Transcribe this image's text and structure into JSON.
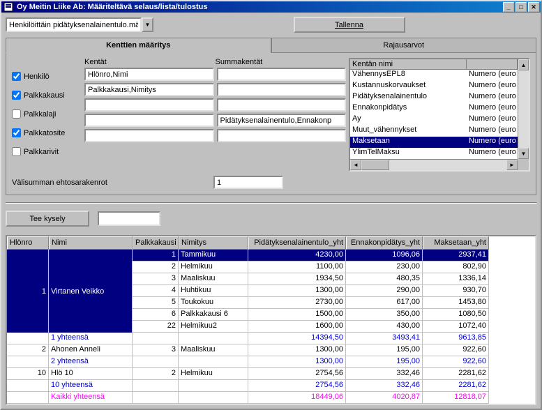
{
  "window": {
    "title": "Oy Meitin Liike Ab: Määriteltävä selaus/lista/tulostus"
  },
  "combo": {
    "value": "Henkilöittäin pidätyksenalainentulo.mäs"
  },
  "buttons": {
    "tallenna": "Tallenna",
    "kysely": "Tee kysely"
  },
  "tabs": {
    "t1": "Kenttien määritys",
    "t2": "Rajausarvot"
  },
  "labels": {
    "kentat": "Kentät",
    "summa": "Summakentät",
    "sumrak": "Välisumman ehtosarakenrot"
  },
  "checks": {
    "henkilo": "Henkilö",
    "palkkakausi": "Palkkakausi",
    "palkkalaji": "Palkkalaji",
    "palkkatosite": "Palkkatosite",
    "palkkarivit": "Palkkarivit"
  },
  "fields": {
    "f1": "Hlönro,Nimi",
    "f2": "Palkkakausi,Nimitys",
    "f3": "",
    "f4": "",
    "f5": "",
    "s1": "",
    "s2": "",
    "s3": "",
    "s4": "Pidätyksenalainentulo,Ennakonp",
    "s5": ""
  },
  "sumval": "1",
  "list": {
    "hdr1": "Kentän nimi",
    "hdr2": "",
    "rows": [
      {
        "n": "VähennysEPL8",
        "t": "Numero (euro"
      },
      {
        "n": "Kustannuskorvaukset",
        "t": "Numero (euro"
      },
      {
        "n": "Pidätyksenalainentulo",
        "t": "Numero (euro"
      },
      {
        "n": "Ennakonpidätys",
        "t": "Numero (euro"
      },
      {
        "n": "Ay",
        "t": "Numero (euro"
      },
      {
        "n": "Muut_vähennykset",
        "t": "Numero (euro"
      },
      {
        "n": "Maksetaan",
        "t": "Numero (euro",
        "sel": true
      },
      {
        "n": "YlimTelMaksu",
        "t": "Numero (euro"
      }
    ]
  },
  "grid": {
    "cols": [
      "Hlönro",
      "Nimi",
      "Palkkakausi",
      "Nimitys",
      "Pidätyksenalainentulo_yht",
      "Ennakonpidätys_yht",
      "Maksetaan_yht"
    ],
    "group": {
      "hlonro": "1",
      "nimi": "Virtanen Veikko"
    },
    "rows": [
      {
        "pk": "1",
        "nim": "Tammikuu",
        "a": "4230,00",
        "b": "1096,06",
        "c": "2937,41",
        "sel": true
      },
      {
        "pk": "2",
        "nim": "Helmikuu",
        "a": "1100,00",
        "b": "230,00",
        "c": "802,90"
      },
      {
        "pk": "3",
        "nim": "Maaliskuu",
        "a": "1934,50",
        "b": "480,35",
        "c": "1336,14"
      },
      {
        "pk": "4",
        "nim": "Huhtikuu",
        "a": "1300,00",
        "b": "290,00",
        "c": "930,70"
      },
      {
        "pk": "5",
        "nim": "Toukokuu",
        "a": "2730,00",
        "b": "617,00",
        "c": "1453,80"
      },
      {
        "pk": "6",
        "nim": "Palkkakausi 6",
        "a": "1500,00",
        "b": "350,00",
        "c": "1080,50"
      },
      {
        "pk": "22",
        "nim": "Helmikuu2",
        "a": "1600,00",
        "b": "430,00",
        "c": "1072,40"
      }
    ],
    "sub1": {
      "label": "1 yhteensä",
      "a": "14394,50",
      "b": "3493,41",
      "c": "9613,85"
    },
    "r2": {
      "hlonro": "2",
      "nimi": "Ahonen Anneli",
      "pk": "3",
      "nim": "Maaliskuu",
      "a": "1300,00",
      "b": "195,00",
      "c": "922,60"
    },
    "sub2": {
      "label": "2 yhteensä",
      "a": "1300,00",
      "b": "195,00",
      "c": "922,60"
    },
    "r3": {
      "hlonro": "10",
      "nimi": "Hlö 10",
      "pk": "2",
      "nim": "Helmikuu",
      "a": "2754,56",
      "b": "332,46",
      "c": "2281,62"
    },
    "sub3": {
      "label": "10 yhteensä",
      "a": "2754,56",
      "b": "332,46",
      "c": "2281,62"
    },
    "tot": {
      "label": "Kaikki yhteensä",
      "a": "18449,06",
      "b": "4020,87",
      "c": "12818,07"
    }
  }
}
